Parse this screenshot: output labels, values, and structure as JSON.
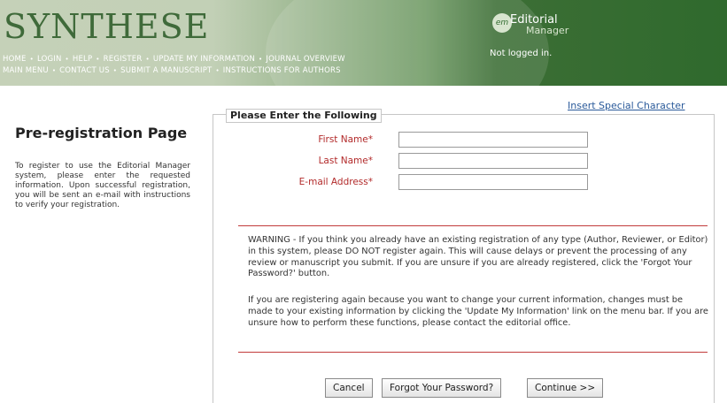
{
  "header": {
    "site_title": "SYNTHESE",
    "nav_row1": [
      "HOME",
      "LOGIN",
      "HELP",
      "REGISTER",
      "UPDATE MY INFORMATION",
      "JOURNAL OVERVIEW"
    ],
    "nav_row2": [
      "MAIN MENU",
      "CONTACT US",
      "SUBMIT A MANUSCRIPT",
      "INSTRUCTIONS FOR AUTHORS"
    ],
    "logo_badge": "em",
    "logo_line1": "Editorial",
    "logo_line2": "Manager",
    "login_status": "Not logged in."
  },
  "left": {
    "title": "Pre-registration Page",
    "intro": "To register to use the Editorial Manager system, please enter the requested information. Upon successful registration, you will be sent an e-mail with instructions to verify your registration."
  },
  "form": {
    "special_char_link": "Insert Special Character",
    "legend": "Please Enter the Following",
    "fields": [
      {
        "label": "First Name*",
        "value": ""
      },
      {
        "label": "Last Name*",
        "value": ""
      },
      {
        "label": "E-mail Address*",
        "value": ""
      }
    ],
    "warning1": "WARNING - If you think you already have an existing registration of any type (Author, Reviewer, or Editor) in this system, please DO NOT register again. This will cause delays or prevent the processing of any review or manuscript you submit. If you are unsure if you are already registered, click the 'Forgot Your Password?' button.",
    "warning2": "If you are registering again because you want to change your current information, changes must be made to your existing information by clicking the 'Update My Information' link on the menu bar. If you are unsure how to perform these functions, please contact the editorial office.",
    "buttons": {
      "cancel": "Cancel",
      "forgot": "Forgot Your Password?",
      "continue": "Continue >>"
    }
  },
  "colors": {
    "header_green": "#2f6a2d",
    "label_red": "#b22a2a",
    "link_blue": "#2a5a9a"
  }
}
